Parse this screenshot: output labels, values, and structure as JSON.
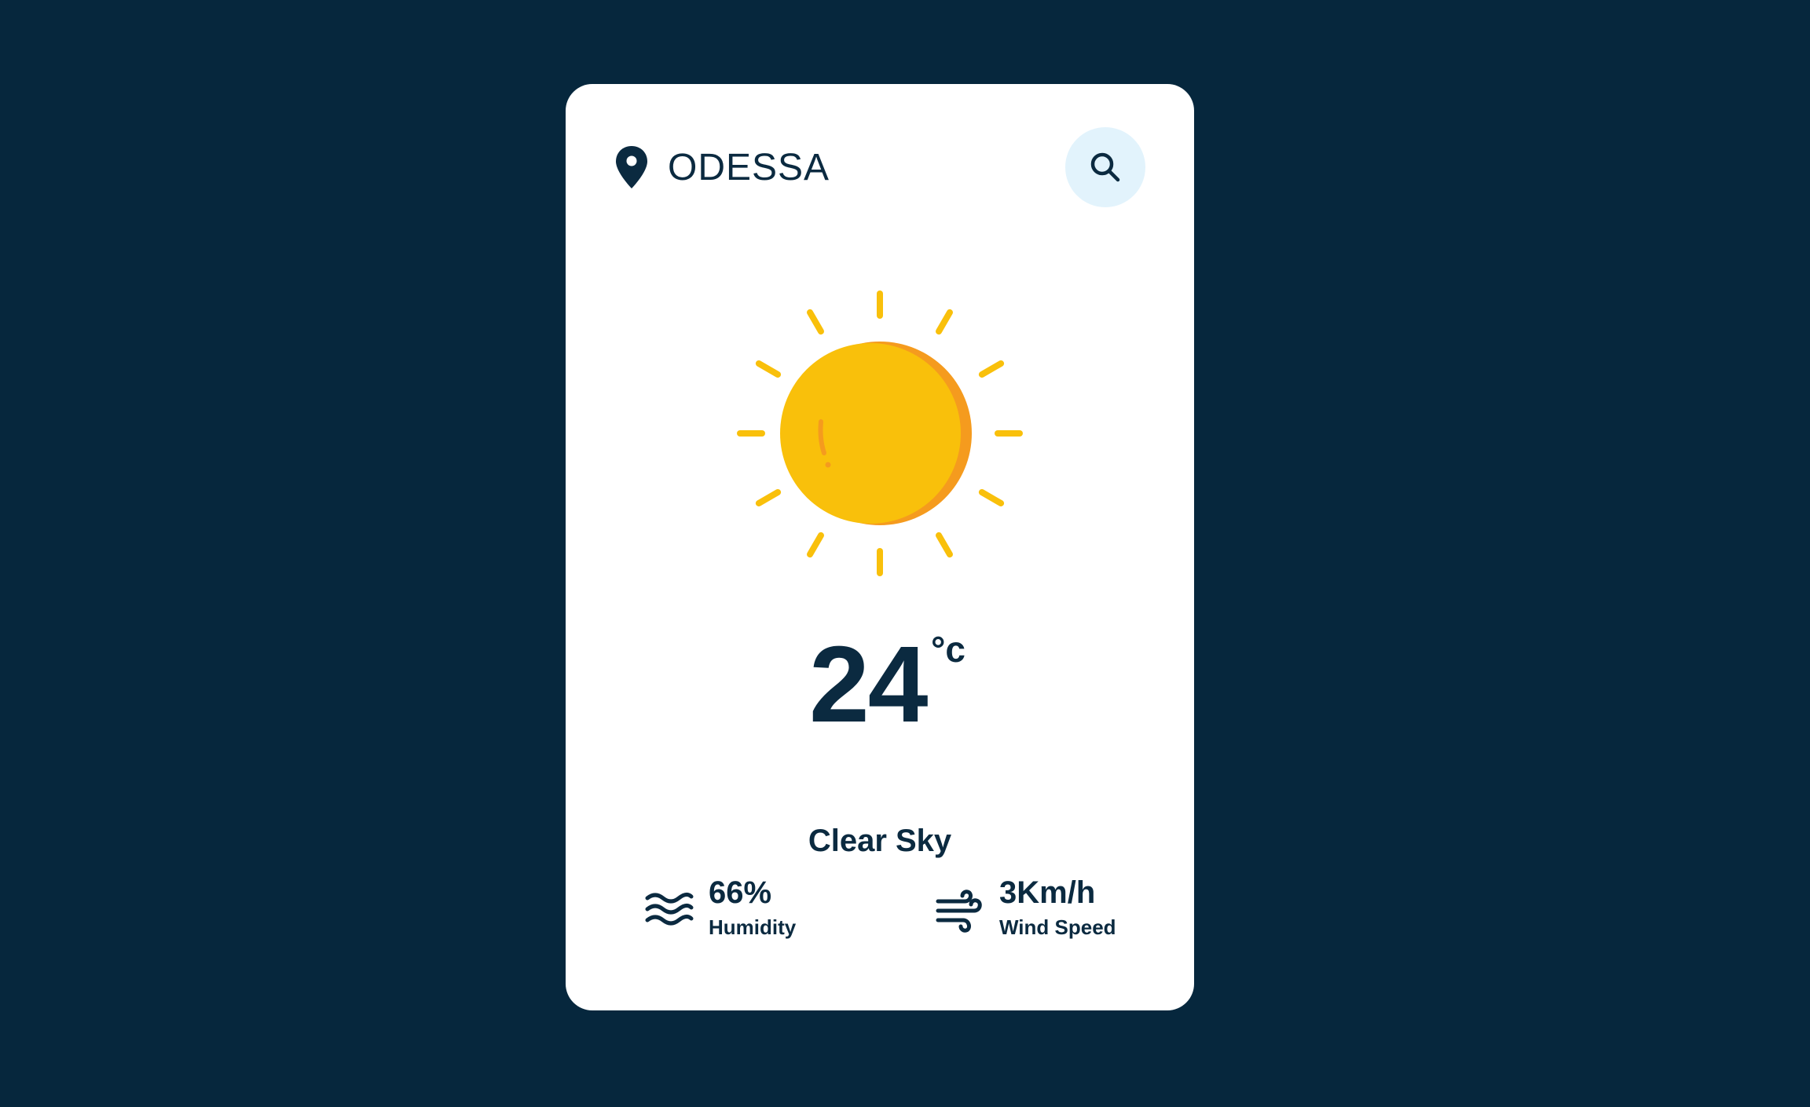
{
  "location": {
    "city": "ODESSA",
    "icon": "map-pin-icon"
  },
  "search": {
    "icon": "search-icon"
  },
  "weather": {
    "icon": "sun-icon",
    "temperature": "24",
    "unit": "°c",
    "condition": "Clear Sky"
  },
  "stats": {
    "humidity": {
      "value": "66%",
      "label": "Humidity",
      "icon": "humidity-waves-icon"
    },
    "wind": {
      "value": "3Km/h",
      "label": "Wind Speed",
      "icon": "wind-icon"
    }
  },
  "colors": {
    "background": "#06273d",
    "card": "#ffffff",
    "text": "#0b2a40",
    "search_button_bg": "#e2f3fc",
    "sun": "#f9c00b",
    "sun_shade": "#f59b1e"
  }
}
